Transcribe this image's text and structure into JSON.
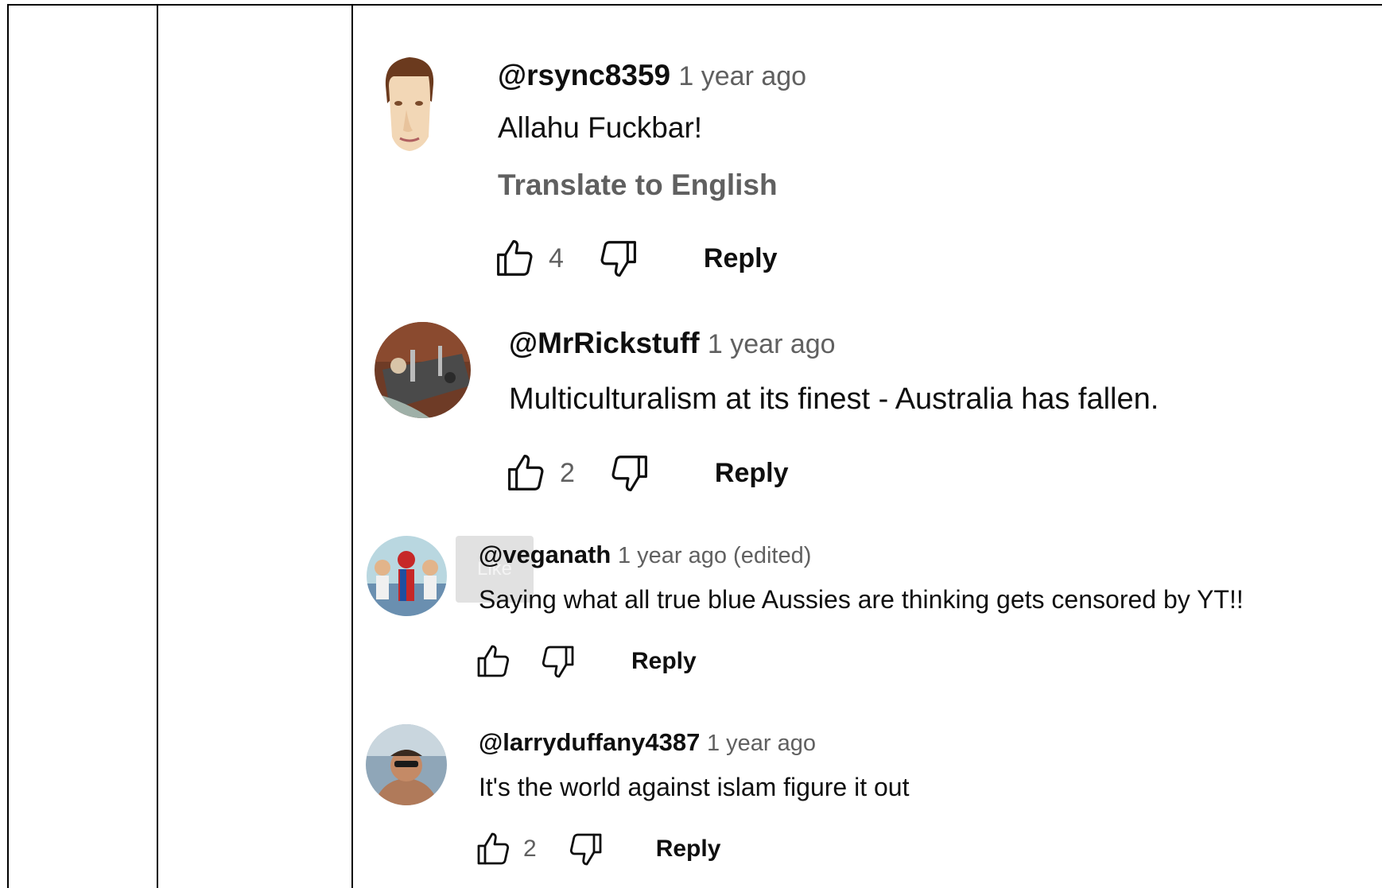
{
  "comments": [
    {
      "author": "@rsync8359",
      "time": "1 year ago",
      "text": "Allahu Fuckbar!",
      "translate": "Translate to English",
      "likes": "4",
      "reply": "Reply",
      "avatar": "cartoon-face"
    },
    {
      "author": "@MrRickstuff",
      "time": "1 year ago",
      "text": "Multiculturalism at its finest - Australia has fallen.",
      "likes": "2",
      "reply": "Reply",
      "avatar": "photo"
    },
    {
      "author": "@veganath",
      "time": "1 year ago (edited)",
      "text": "Saying what all true blue Aussies are thinking gets censored by YT!!",
      "likes": "",
      "reply": "Reply",
      "avatar": "photo-group"
    },
    {
      "author": "@larryduffany4387",
      "time": "1 year ago",
      "text": "It's the world against islam figure it out",
      "likes": "2",
      "reply": "Reply",
      "avatar": "photo-person"
    }
  ],
  "tooltip": "Like",
  "colors": {
    "text": "#0f0f0f",
    "secondary": "#606060"
  }
}
